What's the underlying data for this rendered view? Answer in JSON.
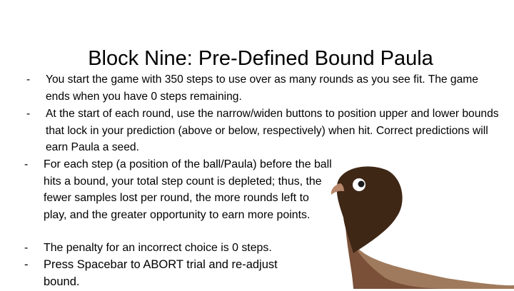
{
  "slide": {
    "title": "Block Nine: Pre-Defined Bound Paula",
    "bullet_marker": "-",
    "bullets": [
      "You start the game with 350 steps to use over as many rounds as you see fit. The game ends when you have 0 steps remaining.",
      "At the start of each round, use the narrow/widen buttons to position upper and lower bounds that lock in your prediction (above or below, respectively) when hit. Correct predictions will earn Paula a seed.",
      "For each step (a position of the ball/Paula) before the ball hits a bound, your total step count is depleted; thus, the fewer samples lost per round, the more rounds left to play, and the greater opportunity to earn more points.",
      "The penalty for an incorrect choice is 0 steps.",
      "Press Spacebar to ABORT trial and re-adjust bound."
    ]
  },
  "illustration": {
    "icon": "pigeon-icon",
    "colors": {
      "head": "#3f2716",
      "neck": "#7a5038",
      "body": "#a07a5c",
      "beak": "#b8866a",
      "eye": "#ffffff",
      "pupil": "#1a1a1a"
    }
  }
}
